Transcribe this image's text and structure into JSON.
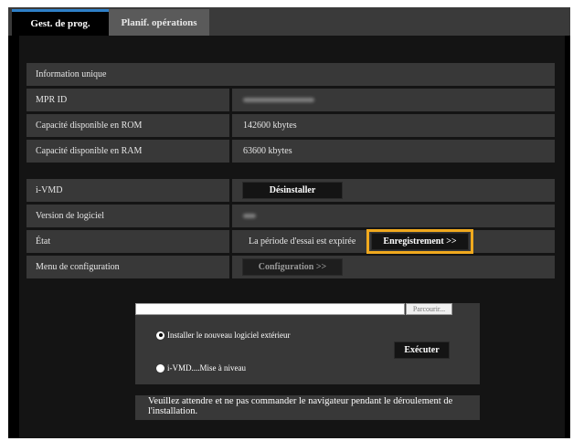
{
  "tabs": [
    {
      "label": "Gest. de prog."
    },
    {
      "label": "Planif. opérations"
    }
  ],
  "unique_info": {
    "header": "Information unique",
    "rows": [
      {
        "label": "MPR ID",
        "value": ""
      },
      {
        "label": "Capacité disponible en ROM",
        "value": "142600 kbytes"
      },
      {
        "label": "Capacité disponible en RAM",
        "value": "63600 kbytes"
      }
    ]
  },
  "app": {
    "name_label": "i-VMD",
    "uninstall_label": "Désinstaller",
    "version_label": "Version de logiciel",
    "version_value": "",
    "state_label": "État",
    "state_value": "La période d'essai est expirée",
    "register_label": "Enregistrement >>",
    "config_menu_label": "Menu de configuration",
    "config_button_label": "Configuration >>"
  },
  "install": {
    "file_value": "",
    "browse_label": "Parcourir...",
    "option_new_label": "Installer le nouveau logiciel extérieur",
    "option_upgrade_label": "i-VMD....Mise à niveau",
    "execute_label": "Exécuter",
    "message": "Veuillez attendre et ne pas commander le navigateur pendant le déroulement de l'installation."
  },
  "colors": {
    "tab_accent": "#2f80c8",
    "highlight": "#f0a91e",
    "row_bg": "#383838"
  }
}
